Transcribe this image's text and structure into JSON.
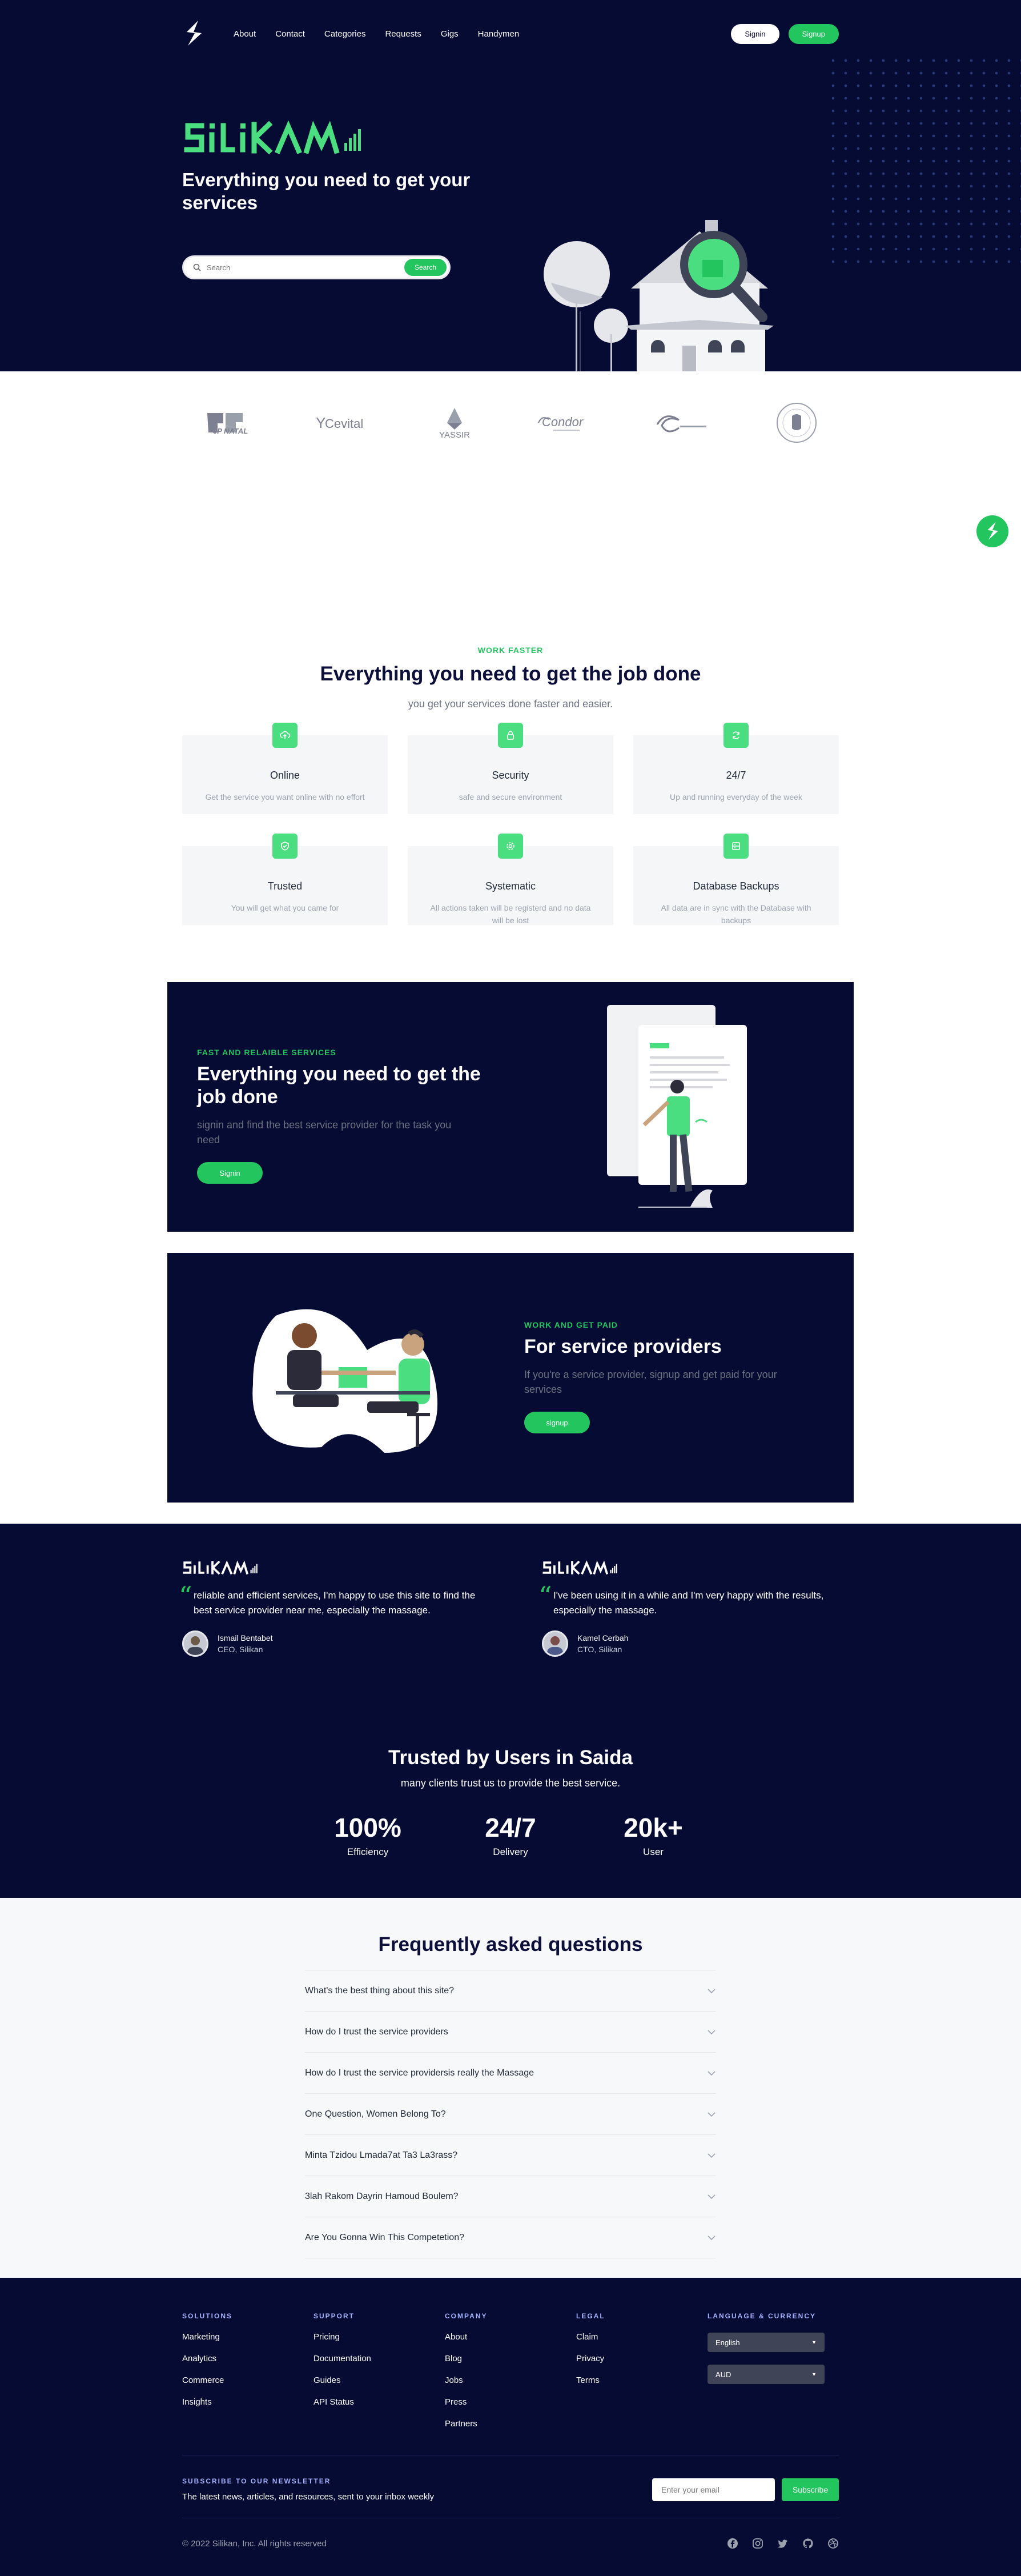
{
  "nav": {
    "links": [
      "About",
      "Contact",
      "Categories",
      "Requests",
      "Gigs",
      "Handymen"
    ],
    "signin": "Signin",
    "signup": "Signup"
  },
  "hero": {
    "brand": "SiliKAN",
    "title": "Everything you need to get your services",
    "search_placeholder": "Search",
    "search_button": "Search"
  },
  "partners": [
    "JP NATAL",
    "Cevital",
    "YASSIR",
    "Condor",
    "",
    ""
  ],
  "features": {
    "eyebrow": "WORK FASTER",
    "title": "Everything you need to get the job done",
    "subtitle": "you get your services done faster and easier.",
    "cards": [
      {
        "title": "Online",
        "desc": "Get the service you want online with no effort",
        "icon": "upload-cloud-icon"
      },
      {
        "title": "Security",
        "desc": "safe and secure environment",
        "icon": "lock-icon"
      },
      {
        "title": "24/7",
        "desc": "Up and running everyday of the week",
        "icon": "refresh-icon"
      },
      {
        "title": "Trusted",
        "desc": "You will get what you came for",
        "icon": "shield-check-icon"
      },
      {
        "title": "Systematic",
        "desc": "All actions taken will be registerd and no data will be lost",
        "icon": "cog-icon"
      },
      {
        "title": "Database Backups",
        "desc": "All data are in sync with the Database with backups",
        "icon": "server-icon"
      }
    ]
  },
  "banner1": {
    "eyebrow": "FAST AND RELAIBLE SERVICES",
    "title": "Everything you need to get the job done",
    "subtitle": "signin and find the best service provider for the task you need",
    "button": "Signin"
  },
  "banner2": {
    "eyebrow": "WORK AND GET PAID",
    "title": "For service providers",
    "subtitle": "If you're a service provider, signup and get paid for your services",
    "button": "signup"
  },
  "testimonials": [
    {
      "brand": "SiliKAN",
      "quote": "reliable and efficient services, I'm happy to use this site to find the best service provider near me, especially the massage.",
      "name": "Ismail Bentabet",
      "role": "CEO, Silikan"
    },
    {
      "brand": "SiliKAN",
      "quote": "I've been using it in a while and I'm very happy with the results, especially the massage.",
      "name": "Kamel Cerbah",
      "role": "CTO, Silikan"
    }
  ],
  "trusted": {
    "title": "Trusted by Users in Saida",
    "subtitle": "many clients trust us to provide the best service.",
    "stats": [
      {
        "value": "100%",
        "label": "Efficiency"
      },
      {
        "value": "24/7",
        "label": "Delivery"
      },
      {
        "value": "20k+",
        "label": "User"
      }
    ]
  },
  "faq": {
    "title": "Frequently asked questions",
    "items": [
      "What's the best thing about this site?",
      "How do I trust the service providers",
      "How do I trust the service providersis really the Massage",
      "One Question, Women Belong To?",
      "Minta Tzidou Lmada7at Ta3 La3rass?",
      "3lah Rakom Dayrin Hamoud Boulem?",
      "Are You Gonna Win This Competetion?"
    ]
  },
  "footer": {
    "columns": [
      {
        "head": "SOLUTIONS",
        "links": [
          "Marketing",
          "Analytics",
          "Commerce",
          "Insights"
        ]
      },
      {
        "head": "SUPPORT",
        "links": [
          "Pricing",
          "Documentation",
          "Guides",
          "API Status"
        ]
      },
      {
        "head": "COMPANY",
        "links": [
          "About",
          "Blog",
          "Jobs",
          "Press",
          "Partners"
        ]
      },
      {
        "head": "LEGAL",
        "links": [
          "Claim",
          "Privacy",
          "Terms"
        ]
      }
    ],
    "lang_head": "LANGUAGE & CURRENCY",
    "language": "English",
    "currency": "AUD",
    "newsletter_head": "SUBSCRIBE TO OUR NEWSLETTER",
    "newsletter_sub": "The latest news, articles, and resources, sent to your inbox weekly",
    "email_placeholder": "Enter your email",
    "subscribe": "Subscribe",
    "copyright": "© 2022 Silikan, Inc. All rights reserved",
    "socials": [
      "facebook-icon",
      "instagram-icon",
      "twitter-icon",
      "github-icon",
      "dribbble-icon"
    ]
  },
  "colors": {
    "navy": "#060b33",
    "green": "#22c55e",
    "light_green": "#4ade80"
  }
}
